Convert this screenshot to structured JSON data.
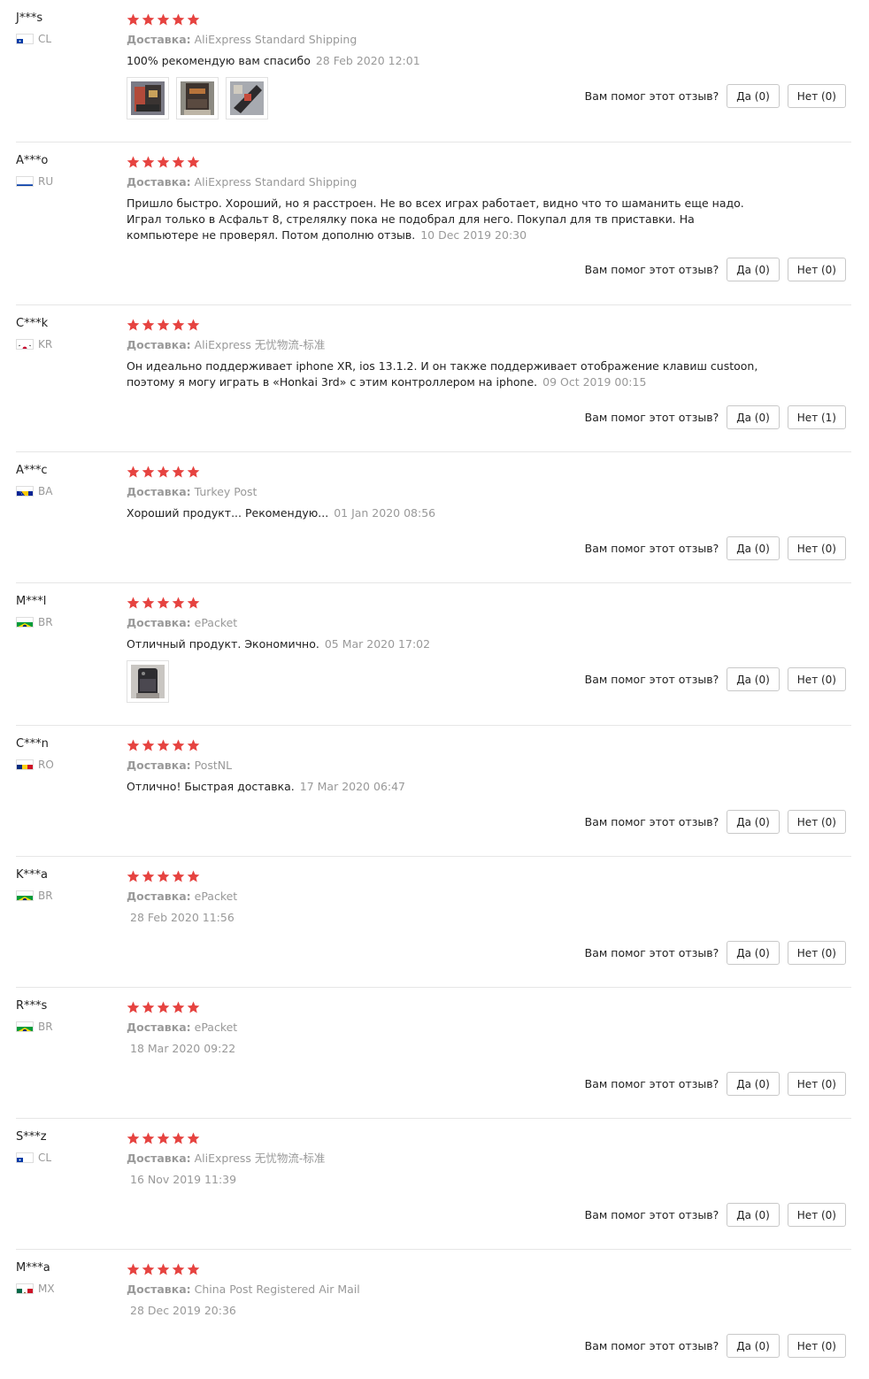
{
  "shipping_label": "Доставка:",
  "helpful_question": "Вам помог этот отзыв?",
  "accent_star_color": "#e64340",
  "reviews": [
    {
      "user": "J***s",
      "country": "CL",
      "flag": "cl",
      "stars": 5,
      "shipping": "AliExpress Standard Shipping",
      "text": "100% рекомендую вам спасибо",
      "date": "28 Feb 2020 12:01",
      "photos": 3,
      "yes_label": "Да (0)",
      "no_label": "Нет (0)"
    },
    {
      "user": "A***o",
      "country": "RU",
      "flag": "ru",
      "stars": 5,
      "shipping": "AliExpress Standard Shipping",
      "text": "Пришло быстро. Хороший, но я расстроен. Не во всех играх работает, видно что то шаманить еще надо. Играл только в Асфальт 8, стрелялку пока не подобрал для него. Покупал для тв приставки. На компьютере не проверял. Потом дополню отзыв.",
      "date": "10 Dec 2019 20:30",
      "photos": 0,
      "yes_label": "Да (0)",
      "no_label": "Нет (0)"
    },
    {
      "user": "C***k",
      "country": "KR",
      "flag": "kr",
      "stars": 5,
      "shipping": "AliExpress 无忧物流-标准",
      "text": "Он идеально поддерживает iphone XR, ios 13.1.2. И он также поддерживает отображение клавиш custoon, поэтому я могу играть в «Honkai 3rd» с этим контроллером на iphone.",
      "date": "09 Oct 2019 00:15",
      "photos": 0,
      "yes_label": "Да (0)",
      "no_label": "Нет (1)"
    },
    {
      "user": "A***c",
      "country": "BA",
      "flag": "ba",
      "stars": 5,
      "shipping": "Turkey Post",
      "text": "Хороший продукт... Рекомендую...",
      "date": "01 Jan 2020 08:56",
      "photos": 0,
      "yes_label": "Да (0)",
      "no_label": "Нет (0)"
    },
    {
      "user": "M***l",
      "country": "BR",
      "flag": "br",
      "stars": 5,
      "shipping": "ePacket",
      "text": "Отличный продукт. Экономично.",
      "date": "05 Mar 2020 17:02",
      "photos": 1,
      "yes_label": "Да (0)",
      "no_label": "Нет (0)"
    },
    {
      "user": "C***n",
      "country": "RO",
      "flag": "ro",
      "stars": 5,
      "shipping": "PostNL",
      "text": "Отлично! Быстрая доставка.",
      "date": "17 Mar 2020 06:47",
      "photos": 0,
      "yes_label": "Да (0)",
      "no_label": "Нет (0)"
    },
    {
      "user": "K***a",
      "country": "BR",
      "flag": "br",
      "stars": 5,
      "shipping": "ePacket",
      "text": "",
      "date": "28 Feb 2020 11:56",
      "photos": 0,
      "yes_label": "Да (0)",
      "no_label": "Нет (0)"
    },
    {
      "user": "R***s",
      "country": "BR",
      "flag": "br",
      "stars": 5,
      "shipping": "ePacket",
      "text": "",
      "date": "18 Mar 2020 09:22",
      "photos": 0,
      "yes_label": "Да (0)",
      "no_label": "Нет (0)"
    },
    {
      "user": "S***z",
      "country": "CL",
      "flag": "cl",
      "stars": 5,
      "shipping": "AliExpress 无忧物流-标准",
      "text": "",
      "date": "16 Nov 2019 11:39",
      "photos": 0,
      "yes_label": "Да (0)",
      "no_label": "Нет (0)"
    },
    {
      "user": "M***a",
      "country": "MX",
      "flag": "mx",
      "stars": 5,
      "shipping": "China Post Registered Air Mail",
      "text": "",
      "date": "28 Dec 2019 20:36",
      "photos": 0,
      "yes_label": "Да (0)",
      "no_label": "Нет (0)"
    }
  ]
}
